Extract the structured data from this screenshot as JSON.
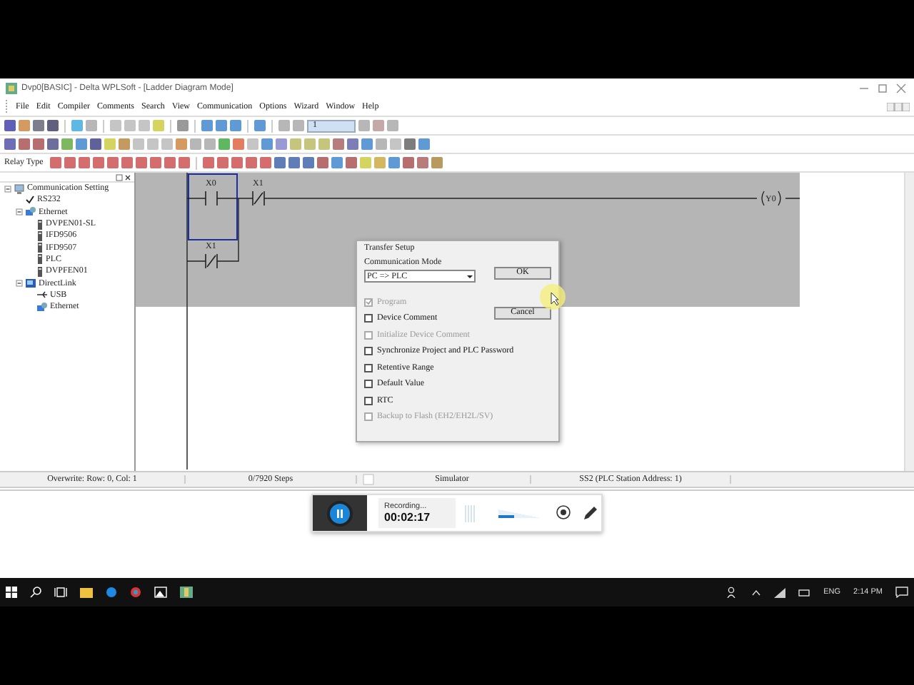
{
  "window": {
    "title": "Dvp0[BASIC] - Delta WPLSoft - [Ladder Diagram Mode]"
  },
  "menu": [
    "File",
    "Edit",
    "Compiler",
    "Comments",
    "Search",
    "View",
    "Communication",
    "Options",
    "Wizard",
    "Window",
    "Help"
  ],
  "toolbar": {
    "station_field": "1",
    "relay_type_label": "Relay Type"
  },
  "tree": [
    {
      "label": "Communication Setting",
      "kind": "computer",
      "expanded": true,
      "children": [
        {
          "label": "RS232",
          "kind": "check"
        },
        {
          "label": "Ethernet",
          "kind": "network",
          "expanded": true,
          "children": [
            {
              "label": "DVPEN01-SL",
              "kind": "device"
            },
            {
              "label": "IFD9506",
              "kind": "device"
            },
            {
              "label": "IFD9507",
              "kind": "device"
            },
            {
              "label": "PLC",
              "kind": "device"
            },
            {
              "label": "DVPFEN01",
              "kind": "device"
            }
          ]
        },
        {
          "label": "DirectLink",
          "kind": "link",
          "expanded": true,
          "children": [
            {
              "label": "USB",
              "kind": "usb"
            },
            {
              "label": "Ethernet",
              "kind": "network"
            }
          ]
        }
      ]
    }
  ],
  "ladder": {
    "contacts": [
      {
        "label": "X0",
        "kind": "no"
      },
      {
        "label": "X1",
        "kind": "nc"
      },
      {
        "label": "X1",
        "kind": "nc"
      }
    ],
    "coil": "Y0"
  },
  "dialog": {
    "title": "Transfer Setup",
    "group_label": "Communication Mode",
    "mode": "PC => PLC",
    "ok": "OK",
    "cancel": "Cancel",
    "options": [
      {
        "label": "Program",
        "checked": true,
        "disabled": true
      },
      {
        "label": "Device Comment",
        "checked": false,
        "disabled": false
      },
      {
        "label": "Initialize Device Comment",
        "checked": false,
        "disabled": true
      },
      {
        "label": "Synchronize Project and PLC Password",
        "checked": false,
        "disabled": false
      },
      {
        "label": "Retentive Range",
        "checked": false,
        "disabled": false
      },
      {
        "label": "Default Value",
        "checked": false,
        "disabled": false
      },
      {
        "label": "RTC",
        "checked": false,
        "disabled": false
      },
      {
        "label": "Backup to Flash (EH2/EH2L/SV)",
        "checked": false,
        "disabled": true
      }
    ]
  },
  "status_bar": [
    "Overwrite: Row: 0, Col: 1",
    "0/7920 Steps",
    "Simulator",
    "SS2 (PLC Station Address: 1)"
  ],
  "recorder": {
    "status": "Recording...",
    "time": "00:02:17",
    "volume": {
      "level": 0.35
    }
  },
  "taskbar": {
    "language": "ENG",
    "clock": "2:14 PM"
  }
}
